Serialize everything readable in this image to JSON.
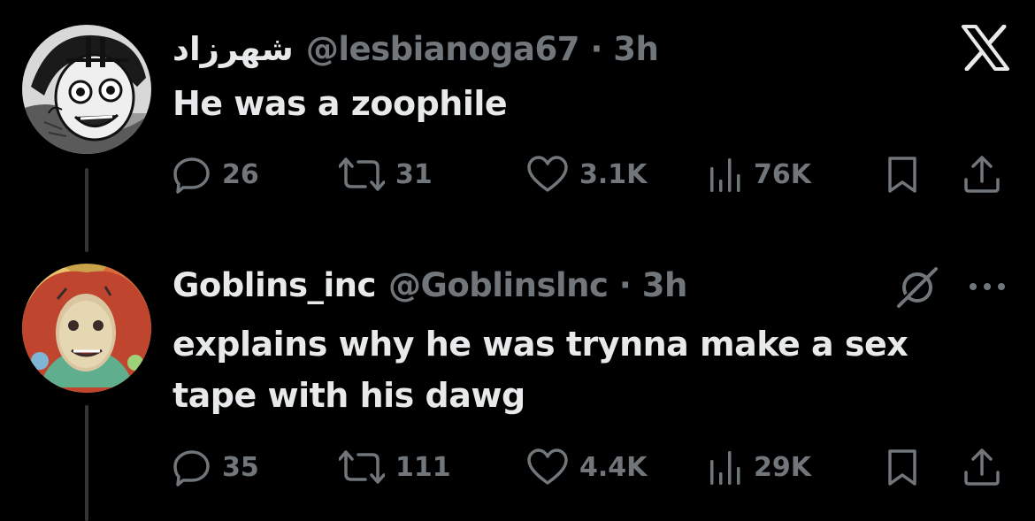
{
  "tweets": [
    {
      "display_name": "شهرزاد",
      "handle_time": "@lesbianoga67 · 3h",
      "text": "He was a zoophile",
      "replies": "26",
      "reposts": "31",
      "likes": "3.1K",
      "views": "76K"
    },
    {
      "display_name": "Goblins_inc",
      "handle_time": "@Goblinslnc · 3h",
      "text": "explains why he was trynna make a sex tape with his dawg",
      "replies": "35",
      "reposts": "111",
      "likes": "4.4K",
      "views": "29K"
    }
  ],
  "icons": {
    "top_right": "x-logo-icon",
    "grok": "grok-icon",
    "more": "more-dots-icon",
    "reply": "reply-icon",
    "repost": "repost-icon",
    "like": "heart-icon",
    "views": "views-icon",
    "bookmark": "bookmark-icon",
    "share": "share-icon"
  },
  "colors": {
    "background": "#000000",
    "text_primary": "#e7e9ea",
    "text_secondary": "#71767b",
    "thread_line": "#333639"
  }
}
